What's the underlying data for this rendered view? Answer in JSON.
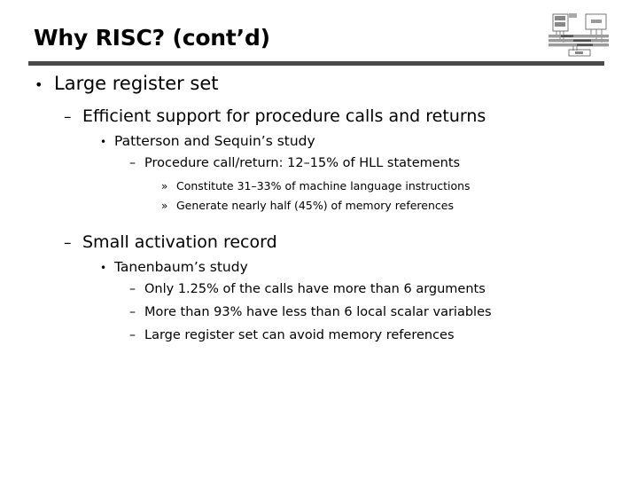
{
  "slide": {
    "title": "Why RISC? (cont’d)",
    "rule_color": "#4a4a4a",
    "background_color": "#ffffff",
    "text_color": "#000000"
  },
  "logo": {
    "name": "computer-architecture-block-diagram",
    "labels": {
      "cpu_alu": "ALU",
      "cpu_reg": "Reg",
      "cpu": "CPU",
      "memory": "Memory",
      "data_bus": "Data Bus",
      "address_bus": "Address Bus",
      "control_bus": "Control Bus",
      "io": "I/O"
    }
  },
  "outline": [
    {
      "level": 1,
      "marker": "•",
      "text": "Large register set"
    },
    {
      "level": 2,
      "marker": "–",
      "text": "Efficient support for procedure calls and returns"
    },
    {
      "level": 3,
      "marker": "•",
      "text": "Patterson and Sequin’s study"
    },
    {
      "level": 4,
      "marker": "–",
      "text": "Procedure call/return: 12–15% of HLL statements"
    },
    {
      "level": 5,
      "marker": "»",
      "text": "Constitute 31–33% of machine language instructions"
    },
    {
      "level": 5,
      "marker": "»",
      "text": "Generate nearly half (45%) of memory references"
    },
    {
      "level": 2,
      "marker": "–",
      "text": "Small activation record"
    },
    {
      "level": 3,
      "marker": "•",
      "text": "Tanenbaum’s study"
    },
    {
      "level": 4,
      "marker": "–",
      "text": "Only 1.25% of the calls have more than 6 arguments"
    },
    {
      "level": 4,
      "marker": "–",
      "text": "More than 93% have less than 6 local scalar variables"
    },
    {
      "level": 4,
      "marker": "–",
      "text": "Large register set can avoid memory references"
    }
  ]
}
